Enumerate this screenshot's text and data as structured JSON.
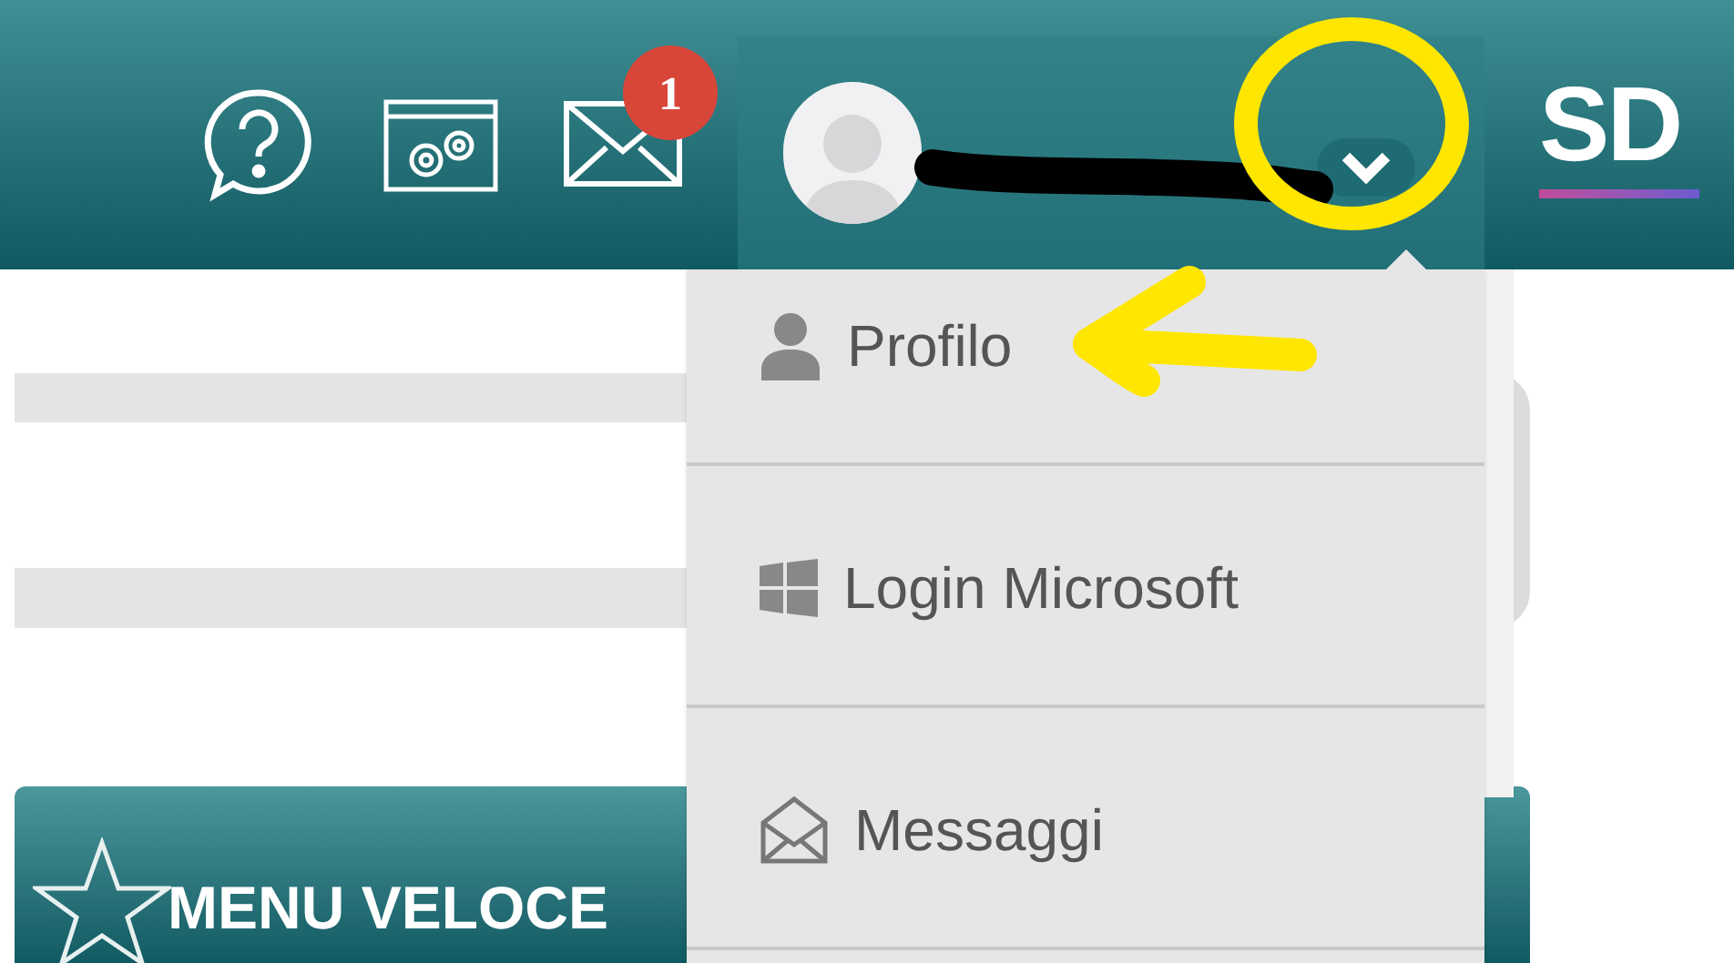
{
  "header": {
    "mail_badge": "1",
    "logo": "SD"
  },
  "user_menu": {
    "items": [
      {
        "kind": "user",
        "label": "Profilo"
      },
      {
        "kind": "windows",
        "label": "Login Microsoft"
      },
      {
        "kind": "envelope",
        "label": "Messaggi"
      }
    ]
  },
  "quick_menu": {
    "title": "MENU VELOCE"
  }
}
